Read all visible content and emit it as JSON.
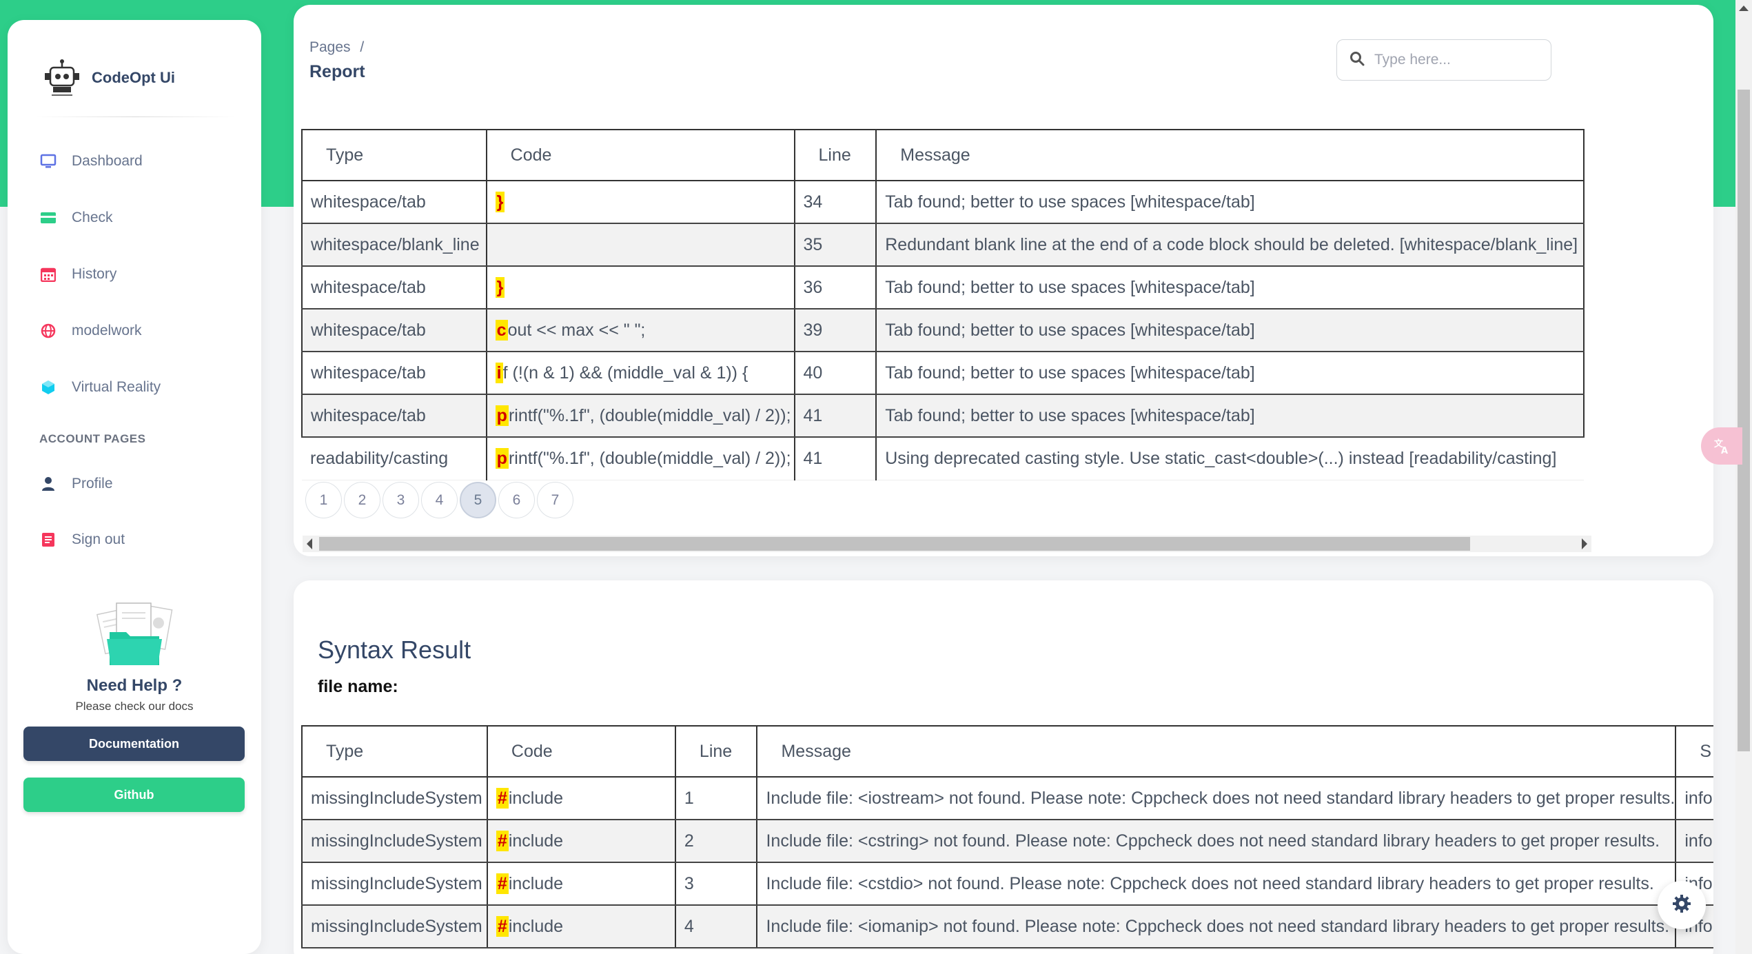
{
  "app": {
    "brand_name": "CodeOpt Ui"
  },
  "sidebar": {
    "items": [
      {
        "label": "Dashboard",
        "icon": "monitor-icon",
        "color": "#5e72e4"
      },
      {
        "label": "Check",
        "icon": "credit-card-icon",
        "color": "#2dce89"
      },
      {
        "label": "History",
        "icon": "calendar-icon",
        "color": "#f5365c"
      },
      {
        "label": "modelwork",
        "icon": "globe-icon",
        "color": "#f5365c"
      },
      {
        "label": "Virtual Reality",
        "icon": "cube-icon",
        "color": "#11cdef"
      }
    ],
    "section_title": "ACCOUNT PAGES",
    "account_items": [
      {
        "label": "Profile",
        "icon": "user-icon",
        "color": "#344767"
      },
      {
        "label": "Sign out",
        "icon": "document-icon",
        "color": "#f5365c"
      }
    ],
    "help": {
      "title": "Need Help ?",
      "subtitle": "Please check our docs"
    },
    "buttons": {
      "documentation": "Documentation",
      "github": "Github"
    }
  },
  "header": {
    "breadcrumb_root": "Pages",
    "breadcrumb_sep": "/",
    "title": "Report",
    "search_placeholder": "Type here..."
  },
  "report_table": {
    "columns": [
      "Type",
      "Code",
      "Line",
      "Message"
    ],
    "rows": [
      {
        "type": "whitespace/tab",
        "code_hl": "}",
        "code_rest": "",
        "line": "34",
        "message": "Tab found; better to use spaces [whitespace/tab]"
      },
      {
        "type": "whitespace/blank_line",
        "code_hl": "",
        "code_rest": "",
        "line": "35",
        "message": "Redundant blank line at the end of a code block should be deleted. [whitespace/blank_line]"
      },
      {
        "type": "whitespace/tab",
        "code_hl": "}",
        "code_rest": "",
        "line": "36",
        "message": "Tab found; better to use spaces [whitespace/tab]"
      },
      {
        "type": "whitespace/tab",
        "code_hl": "c",
        "code_rest": "out << max << \" \";",
        "line": "39",
        "message": "Tab found; better to use spaces [whitespace/tab]"
      },
      {
        "type": "whitespace/tab",
        "code_hl": "i",
        "code_rest": "f (!(n & 1) && (middle_val & 1)) {",
        "line": "40",
        "message": "Tab found; better to use spaces [whitespace/tab]"
      },
      {
        "type": "whitespace/tab",
        "code_hl": "p",
        "code_rest": "rintf(\"%.1f\", (double(middle_val) / 2));",
        "line": "41",
        "message": "Tab found; better to use spaces [whitespace/tab]"
      },
      {
        "type": "readability/casting",
        "code_hl": "p",
        "code_rest": "rintf(\"%.1f\", (double(middle_val) / 2));",
        "line": "41",
        "message": "Using deprecated casting style. Use static_cast<double>(...) instead [readability/casting]"
      }
    ]
  },
  "pagination": {
    "pages": [
      "1",
      "2",
      "3",
      "4",
      "5",
      "6",
      "7"
    ],
    "active": "5"
  },
  "syntax": {
    "title": "Syntax Result",
    "file_name_label": "file name:",
    "columns": [
      "Type",
      "Code",
      "Line",
      "Message",
      "S"
    ],
    "rows": [
      {
        "type": "missingIncludeSystem",
        "code_hl": "#",
        "code_rest": "include",
        "line": "1",
        "message": "Include file: <iostream> not found. Please note: Cppcheck does not need standard library headers to get proper results.",
        "severity": "info"
      },
      {
        "type": "missingIncludeSystem",
        "code_hl": "#",
        "code_rest": "include",
        "line": "2",
        "message": "Include file: <cstring> not found. Please note: Cppcheck does not need standard library headers to get proper results.",
        "severity": "info"
      },
      {
        "type": "missingIncludeSystem",
        "code_hl": "#",
        "code_rest": "include",
        "line": "3",
        "message": "Include file: <cstdio> not found. Please note: Cppcheck does not need standard library headers to get proper results.",
        "severity": "info"
      },
      {
        "type": "missingIncludeSystem",
        "code_hl": "#",
        "code_rest": "include",
        "line": "4",
        "message": "Include file: <iomanip> not found. Please note: Cppcheck does not need standard library headers to get proper results.",
        "severity": "info"
      }
    ]
  },
  "colors": {
    "accent_green": "#2dce89",
    "dark": "#344767",
    "highlight_bg": "#ffe600",
    "highlight_fg": "#d10000"
  }
}
